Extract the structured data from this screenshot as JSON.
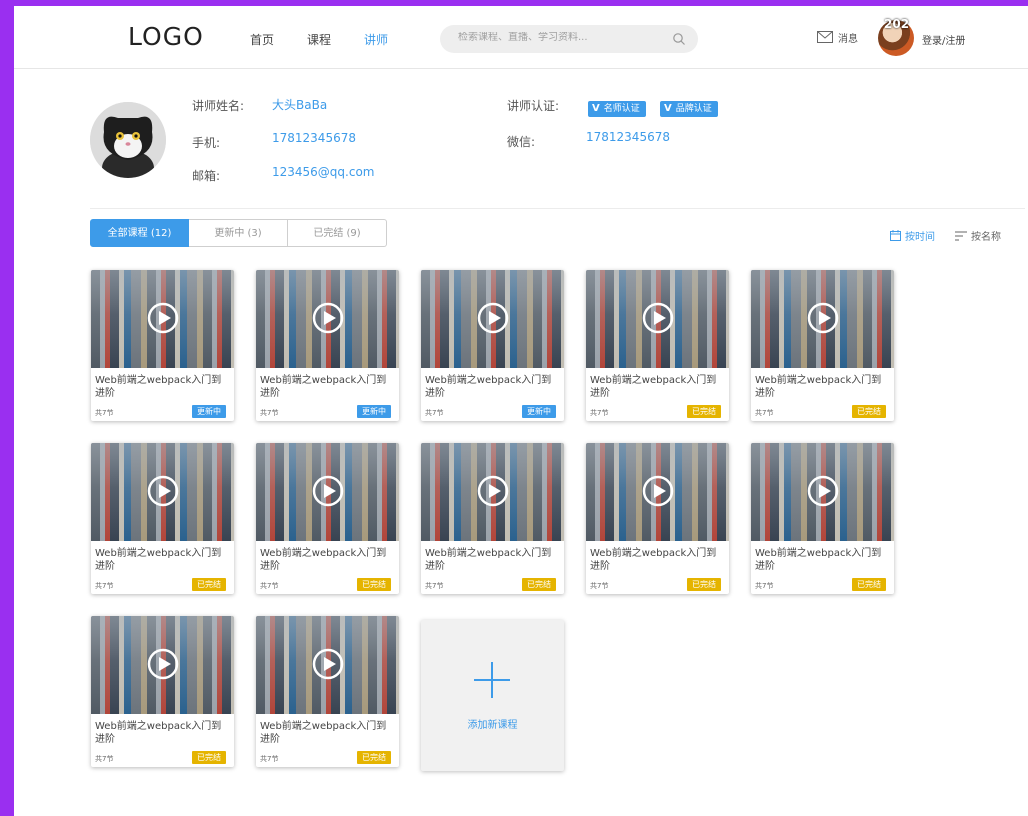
{
  "header": {
    "logo": "LOGO",
    "nav": [
      "首页",
      "课程",
      "讲师"
    ],
    "search_placeholder": "检索课程、直播、学习资料...",
    "messages_label": "消息",
    "avatar_text": "202",
    "login_label": "登录/注册"
  },
  "profile": {
    "name_label": "讲师姓名:",
    "name": "大头BaBa",
    "phone_label": "手机:",
    "phone": "17812345678",
    "email_label": "邮箱:",
    "email": "123456@qq.com",
    "cert_label": "讲师认证:",
    "certs": [
      "名师认证",
      "品牌认证"
    ],
    "wechat_label": "微信:",
    "wechat": "17812345678"
  },
  "tabs": [
    "全部课程 (12)",
    "更新中 (3)",
    "已完结 (9)"
  ],
  "sort": {
    "by_time": "按时间",
    "by_name": "按名称"
  },
  "courses": [
    {
      "title": "Web前端之webpack入门到进阶",
      "count": "共7节",
      "status": "更新中"
    },
    {
      "title": "Web前端之webpack入门到进阶",
      "count": "共7节",
      "status": "更新中"
    },
    {
      "title": "Web前端之webpack入门到进阶",
      "count": "共7节",
      "status": "更新中"
    },
    {
      "title": "Web前端之webpack入门到进阶",
      "count": "共7节",
      "status": "已完结"
    },
    {
      "title": "Web前端之webpack入门到进阶",
      "count": "共7节",
      "status": "已完结"
    },
    {
      "title": "Web前端之webpack入门到进阶",
      "count": "共7节",
      "status": "已完结"
    },
    {
      "title": "Web前端之webpack入门到进阶",
      "count": "共7节",
      "status": "已完结"
    },
    {
      "title": "Web前端之webpack入门到进阶",
      "count": "共7节",
      "status": "已完结"
    },
    {
      "title": "Web前端之webpack入门到进阶",
      "count": "共7节",
      "status": "已完结"
    },
    {
      "title": "Web前端之webpack入门到进阶",
      "count": "共7节",
      "status": "已完结"
    },
    {
      "title": "Web前端之webpack入门到进阶",
      "count": "共7节",
      "status": "已完结"
    },
    {
      "title": "Web前端之webpack入门到进阶",
      "count": "共7节",
      "status": "已完结"
    }
  ],
  "add_course_label": "添加新课程",
  "colors": {
    "accent": "#3d9be9",
    "done": "#e5b400",
    "frame": "#9a2ff0"
  }
}
